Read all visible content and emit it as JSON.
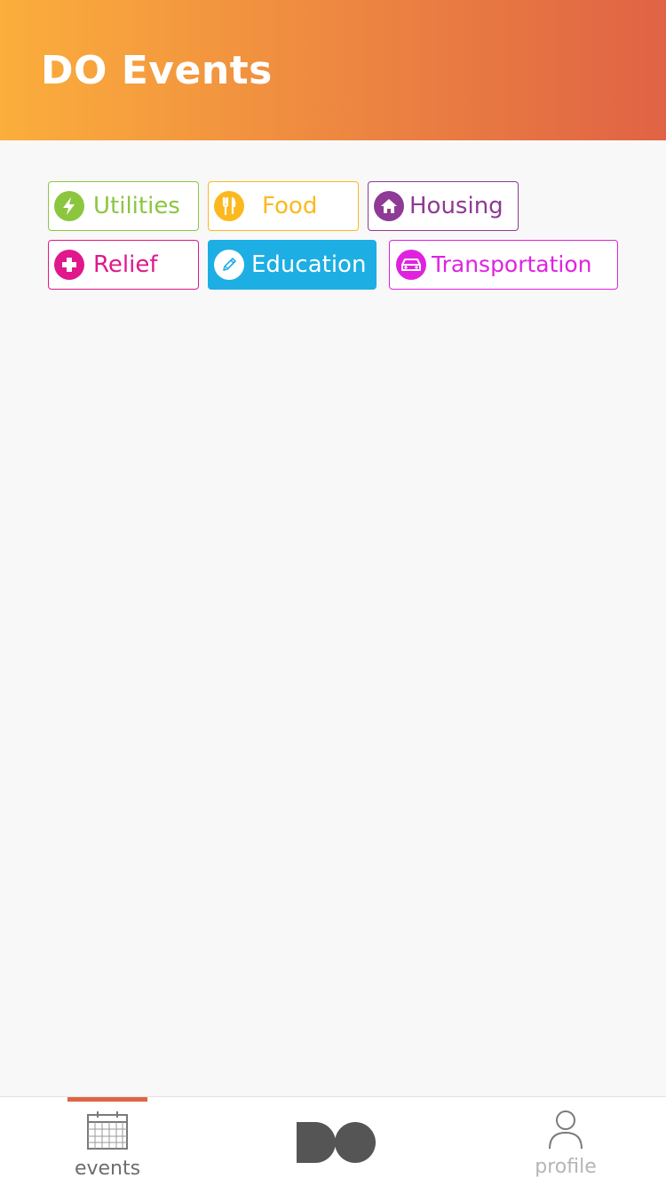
{
  "header": {
    "title": "DO Events"
  },
  "filters": {
    "utilities": {
      "label": "Utilities",
      "icon": "bolt-icon",
      "color": "#8cc63f"
    },
    "food": {
      "label": "Food",
      "icon": "utensils-icon",
      "color": "#fbb91f"
    },
    "housing": {
      "label": "Housing",
      "icon": "home-icon",
      "color": "#8e3a96"
    },
    "relief": {
      "label": "Relief",
      "icon": "plus-icon",
      "color": "#e0188c"
    },
    "education": {
      "label": "Education",
      "icon": "pencil-icon",
      "color": "#1daee4",
      "selected": true
    },
    "transportation": {
      "label": "Transportation",
      "icon": "car-icon",
      "color": "#e022e0"
    }
  },
  "tabbar": {
    "events_label": "events",
    "profile_label": "profile",
    "active_tab": "events",
    "accent": "#e06345"
  }
}
